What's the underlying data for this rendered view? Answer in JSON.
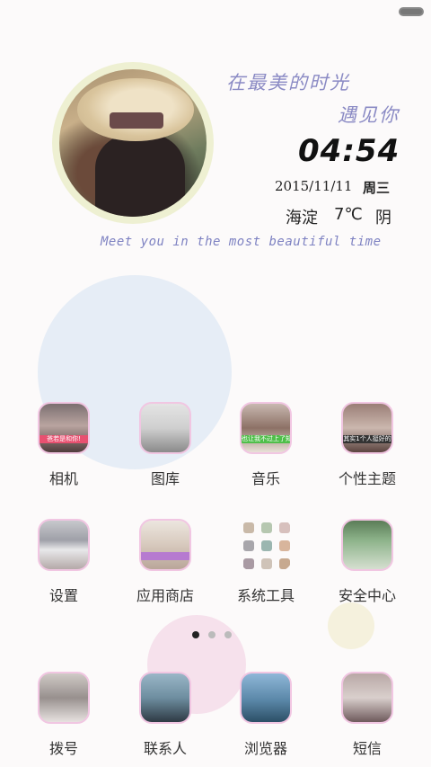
{
  "status_bar": {
    "battery_icon": "battery-icon"
  },
  "clock_widget": {
    "tagline_cn_line1": "在最美的时光",
    "tagline_cn_line2": "遇见你",
    "time": "04:54",
    "date": "2015/11/11",
    "weekday": "周三",
    "location": "海淀",
    "temperature": "7℃",
    "condition": "阴",
    "tagline_en": "Meet you in the most beautiful time"
  },
  "apps_row1": [
    {
      "label": "相机",
      "banner": "爸若是和你!"
    },
    {
      "label": "图库"
    },
    {
      "label": "音乐",
      "banner": "也让我不过上了知道真是"
    },
    {
      "label": "个性主题",
      "banner": "其实1个人挺好的"
    }
  ],
  "apps_row2": [
    {
      "label": "设置"
    },
    {
      "label": "应用商店"
    },
    {
      "label": "系统工具"
    },
    {
      "label": "安全中心"
    }
  ],
  "dock": [
    {
      "label": "拨号"
    },
    {
      "label": "联系人"
    },
    {
      "label": "浏览器"
    },
    {
      "label": "短信"
    }
  ],
  "page_indicator": {
    "pages": 3,
    "current": 1
  },
  "colors": {
    "accent_lavender": "#8a8ac4",
    "icon_border_pink": "#f1c6e2",
    "deco_blue": "#e6edf6",
    "deco_pink": "#f6e1ec",
    "deco_cream": "#f5f1dd"
  }
}
